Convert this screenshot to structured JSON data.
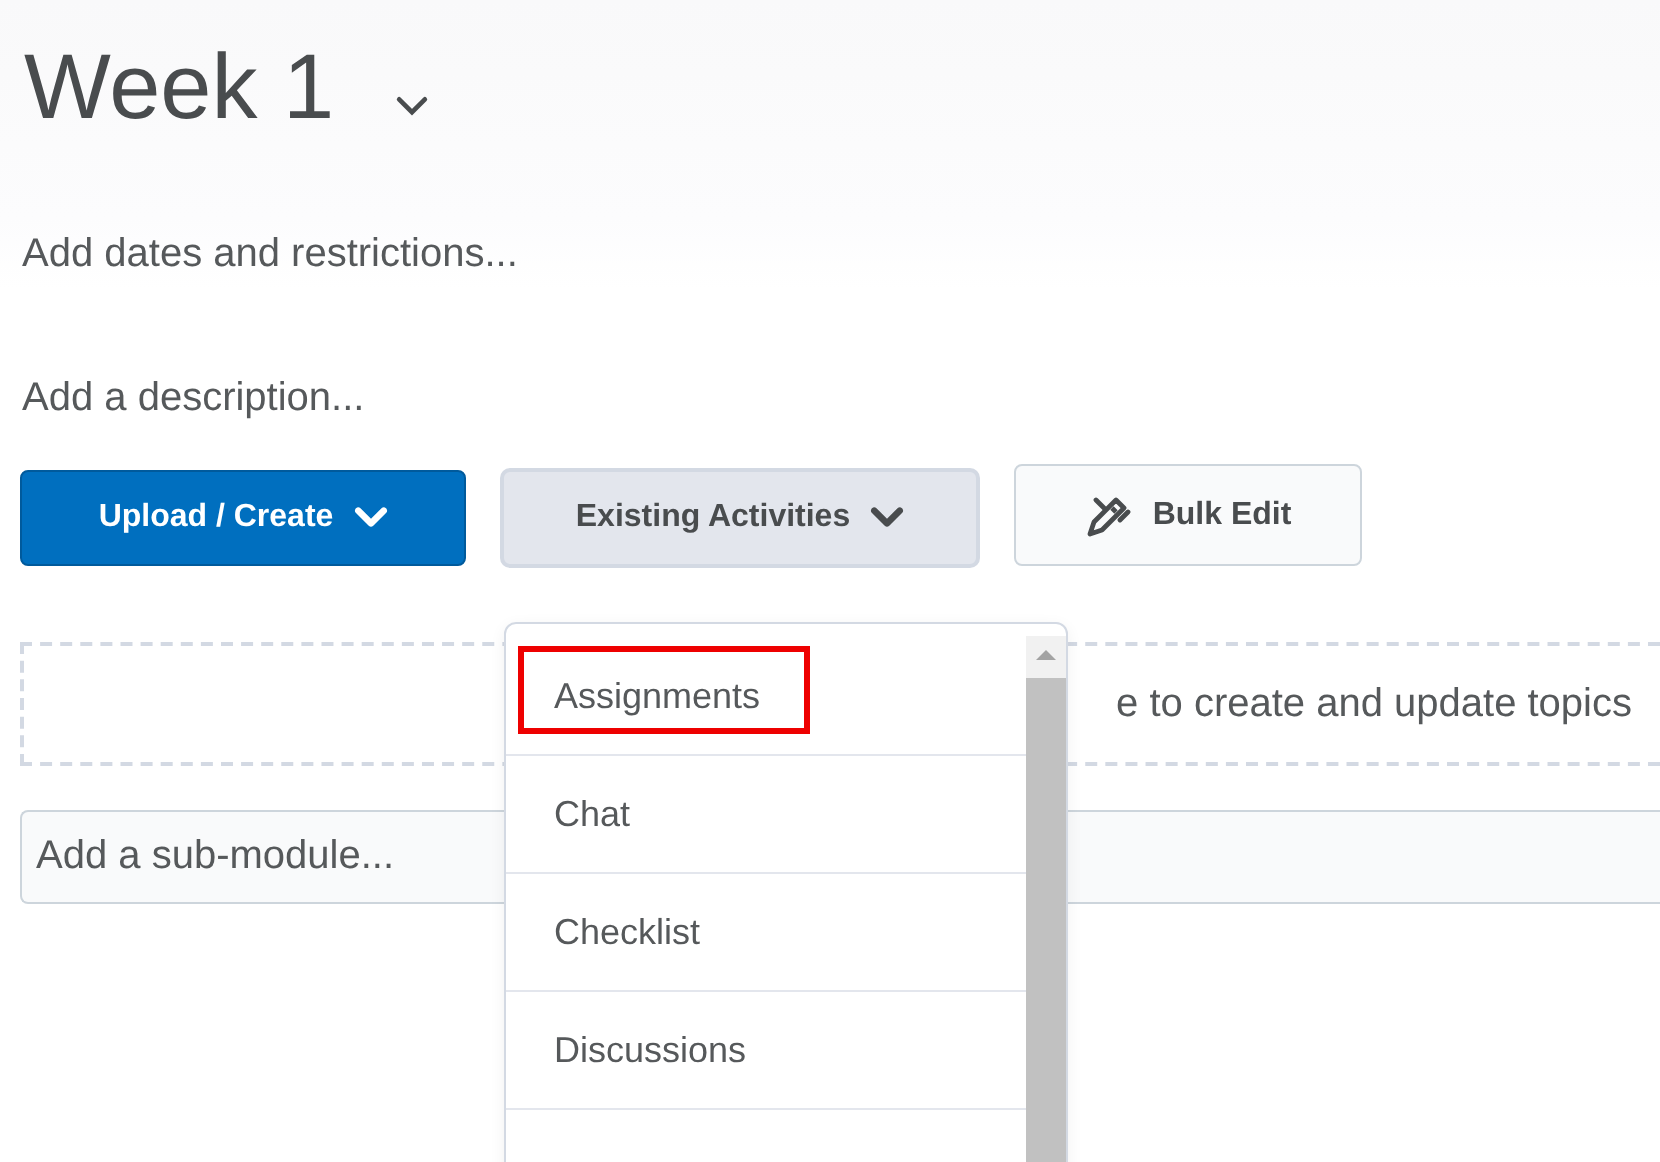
{
  "module": {
    "title": "Week 1",
    "dates_link": "Add dates and restrictions...",
    "description_link": "Add a description..."
  },
  "buttons": [
    {
      "kind": "primary",
      "label": "Upload / Create"
    },
    {
      "kind": "secondary",
      "label": "Existing Activities",
      "expanded": true
    },
    {
      "kind": "plain",
      "label": "Bulk Edit"
    }
  ],
  "drop_zone": {
    "text": "e to create and update topics"
  },
  "sub_module": {
    "placeholder": "Add a sub-module..."
  },
  "dropdown": {
    "items": [
      {
        "label": "Assignments",
        "highlighted": true
      },
      {
        "label": "Chat",
        "highlighted": false
      },
      {
        "label": "Checklist",
        "highlighted": false
      },
      {
        "label": "Discussions",
        "highlighted": false
      }
    ]
  }
}
